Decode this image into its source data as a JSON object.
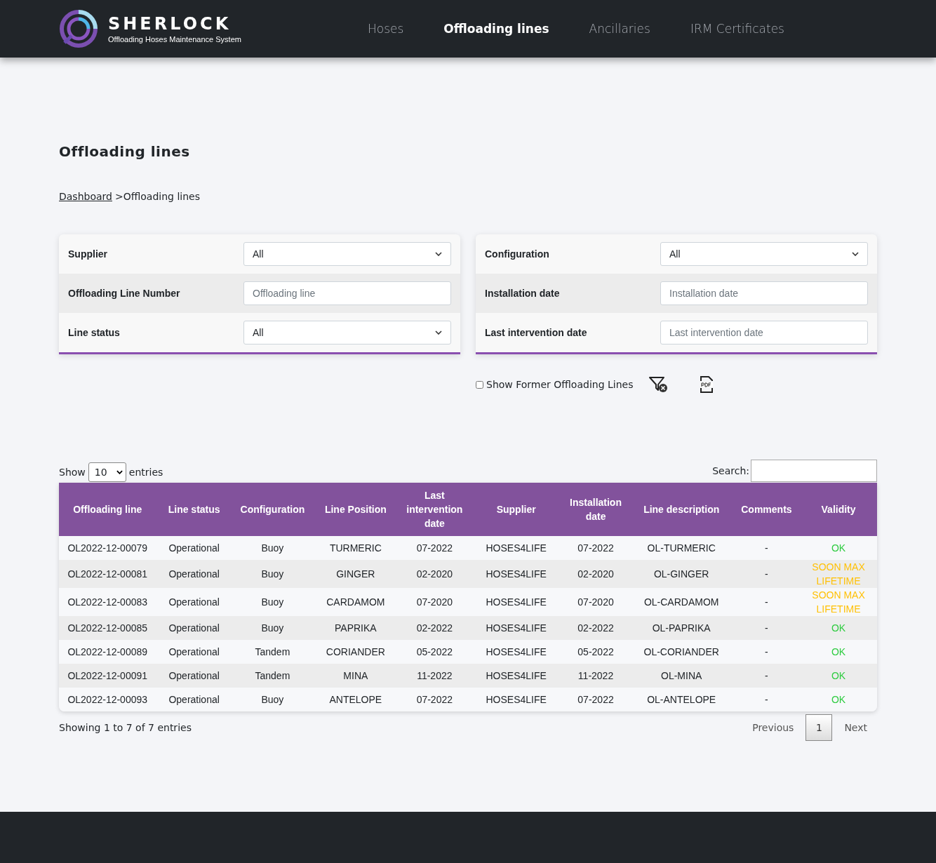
{
  "brand": {
    "name": "SHERLOCK",
    "tagline": "Offloading Hoses Maintenance System"
  },
  "nav": [
    {
      "label": "Hoses",
      "selected": false
    },
    {
      "label": "Offloading lines",
      "selected": true
    },
    {
      "label": "Ancillaries",
      "selected": false
    },
    {
      "label": "IRM Certificates",
      "selected": false
    }
  ],
  "page_title": "Offloading lines",
  "breadcrumb": {
    "link": "Dashboard",
    "current": ">Offloading lines"
  },
  "filters": [
    [
      {
        "label": "Supplier",
        "kind": "select",
        "value": "All"
      },
      {
        "label": "Offloading Line Number",
        "kind": "input",
        "placeholder": "Offloading line"
      },
      {
        "label": "Line status",
        "kind": "select",
        "value": "All"
      }
    ],
    [
      {
        "label": "Configuration",
        "kind": "select",
        "value": "All"
      },
      {
        "label": "Installation date",
        "kind": "input",
        "placeholder": "Installation date"
      },
      {
        "label": "Last intervention date",
        "kind": "input",
        "placeholder": "Last intervention date"
      }
    ]
  ],
  "show_former": {
    "label": "Show Former Offloading Lines",
    "checked": false
  },
  "length": {
    "show": "Show",
    "value": "10",
    "entries": "entries"
  },
  "search": {
    "label": "Search:"
  },
  "table": {
    "columns": [
      "Offloading line",
      "Line status",
      "Configuration",
      "Line Position",
      "Last intervention date",
      "Supplier",
      "Installation date",
      "Line description",
      "Comments",
      "Validity"
    ],
    "rows": [
      {
        "cells": [
          "OL2022-12-00079",
          "Operational",
          "Buoy",
          "TURMERIC",
          "07-2022",
          "HOSES4LIFE",
          "07-2022",
          "OL-TURMERIC",
          "-"
        ],
        "validity": "OK",
        "color": "#2ecc40"
      },
      {
        "cells": [
          "OL2022-12-00081",
          "Operational",
          "Buoy",
          "GINGER",
          "02-2020",
          "HOSES4LIFE",
          "02-2020",
          "OL-GINGER",
          "-"
        ],
        "validity": "SOON MAX LIFETIME",
        "color": "#ffc107"
      },
      {
        "cells": [
          "OL2022-12-00083",
          "Operational",
          "Buoy",
          "CARDAMOM",
          "07-2020",
          "HOSES4LIFE",
          "07-2020",
          "OL-CARDAMOM",
          "-"
        ],
        "validity": "SOON MAX LIFETIME",
        "color": "#ffc107"
      },
      {
        "cells": [
          "OL2022-12-00085",
          "Operational",
          "Buoy",
          "PAPRIKA",
          "02-2022",
          "HOSES4LIFE",
          "02-2022",
          "OL-PAPRIKA",
          "-"
        ],
        "validity": "OK",
        "color": "#2ecc40"
      },
      {
        "cells": [
          "OL2022-12-00089",
          "Operational",
          "Tandem",
          "CORIANDER",
          "05-2022",
          "HOSES4LIFE",
          "05-2022",
          "OL-CORIANDER",
          "-"
        ],
        "validity": "OK",
        "color": "#2ecc40"
      },
      {
        "cells": [
          "OL2022-12-00091",
          "Operational",
          "Tandem",
          "MINA",
          "11-2022",
          "HOSES4LIFE",
          "11-2022",
          "OL-MINA",
          "-"
        ],
        "validity": "OK",
        "color": "#2ecc40"
      },
      {
        "cells": [
          "OL2022-12-00093",
          "Operational",
          "Buoy",
          "ANTELOPE",
          "07-2022",
          "HOSES4LIFE",
          "07-2022",
          "OL-ANTELOPE",
          "-"
        ],
        "validity": "OK",
        "color": "#2ecc40"
      }
    ]
  },
  "info": "Showing 1 to 7 of 7 entries",
  "pagination": {
    "previous": "Previous",
    "pages": [
      {
        "label": "1",
        "selected": true
      }
    ],
    "next": "Next"
  }
}
